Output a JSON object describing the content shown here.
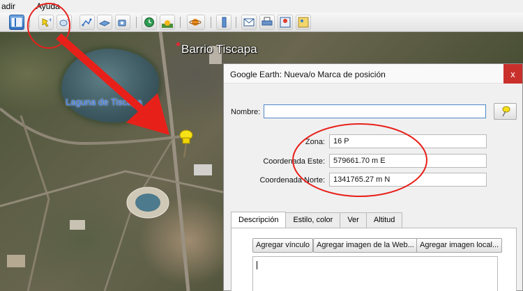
{
  "menu": {
    "items": [
      "adir",
      "Ayuda"
    ]
  },
  "toolbar": {
    "buttons": [
      {
        "icon": "sidebar-icon"
      },
      {
        "icon": "add-placemark-icon"
      },
      {
        "icon": "add-polygon-icon"
      },
      {
        "icon": "add-path-icon"
      },
      {
        "icon": "add-image-overlay-icon"
      },
      {
        "icon": "record-tour-icon"
      },
      {
        "icon": "historical-imagery-icon"
      },
      {
        "icon": "sunlight-icon"
      },
      {
        "icon": "planets-icon"
      },
      {
        "icon": "ruler-icon"
      },
      {
        "icon": "email-icon"
      },
      {
        "icon": "print-icon"
      },
      {
        "icon": "view-in-google-maps-icon"
      },
      {
        "icon": "save-image-icon"
      }
    ]
  },
  "map": {
    "labels": {
      "barrio": "Barrio Tiscapa",
      "laguna": "Laguna de Tiscapa"
    }
  },
  "dialog": {
    "title": "Google Earth: Nueva/o Marca de posición",
    "close": "x",
    "name_label": "Nombre:",
    "name_value": "",
    "zona_label": "Zona:",
    "zona_value": "16 P",
    "este_label": "Coordenada Este:",
    "este_value": "579661.70 m E",
    "norte_label": "Coordenada Norte:",
    "norte_value": "1341765.27 m N",
    "tabs": [
      "Descripción",
      "Estilo, color",
      "Ver",
      "Altitud"
    ],
    "active_tab": "Descripción",
    "buttons": {
      "link": "Agregar vínculo",
      "web_image": "Agregar imagen de la Web...",
      "local_image": "Agregar imagen local..."
    },
    "description_value": ""
  },
  "colors": {
    "annotation": "#e8201a",
    "accent": "#2f6fc0",
    "close": "#c9302c",
    "laguna_label": "#3e7ef5"
  }
}
